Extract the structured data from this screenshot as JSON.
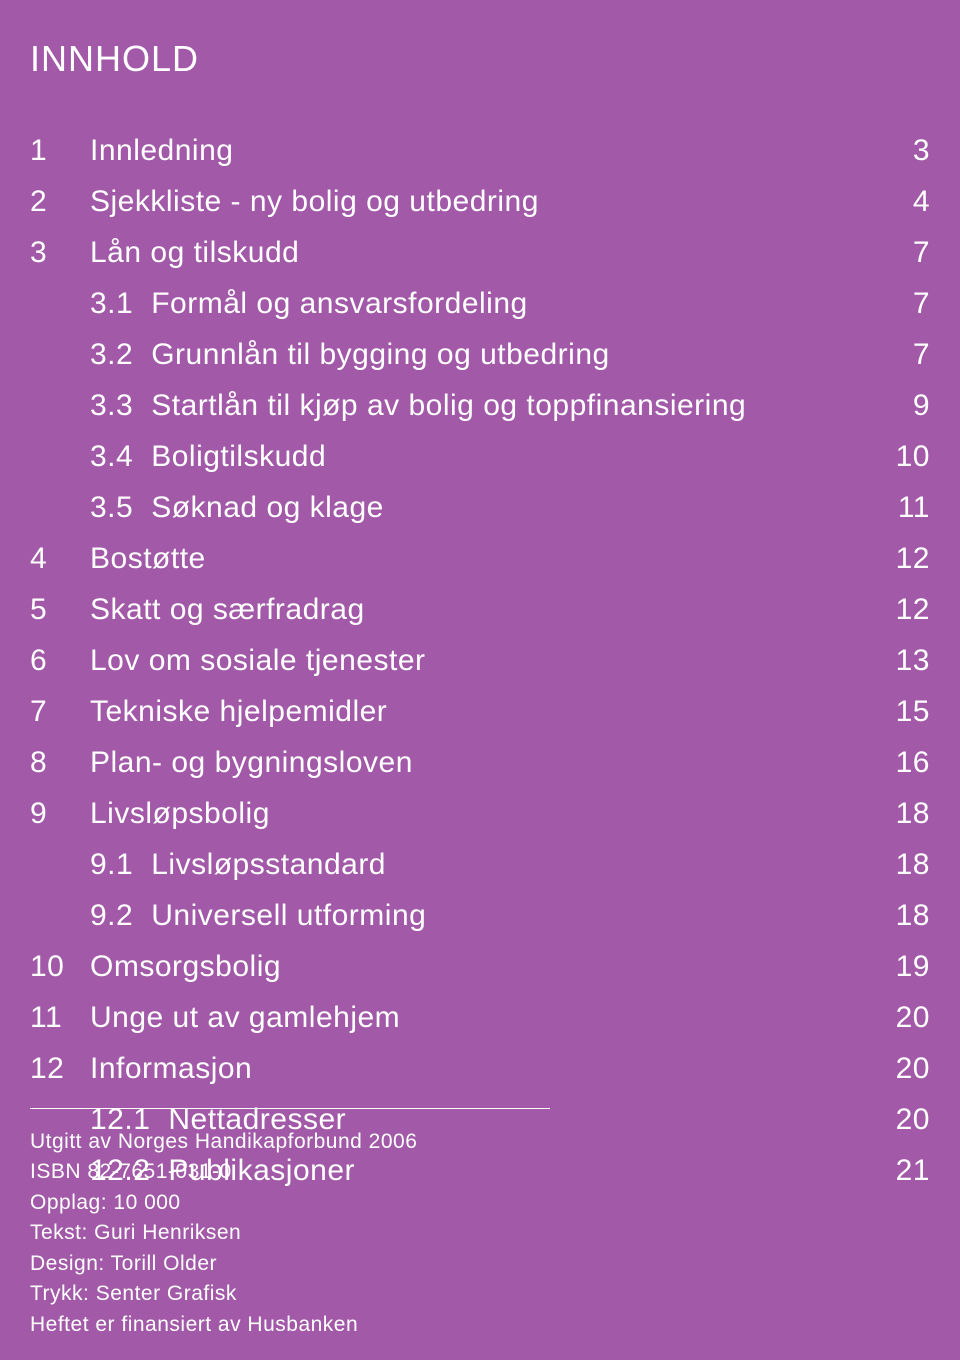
{
  "title": "INNHOLD",
  "toc": [
    {
      "num": "1",
      "sub": "",
      "label": "Innledning",
      "page": "3"
    },
    {
      "num": "2",
      "sub": "",
      "label": "Sjekkliste - ny bolig og utbedring",
      "page": "4"
    },
    {
      "num": "3",
      "sub": "",
      "label": "Lån og tilskudd",
      "page": "7"
    },
    {
      "num": "",
      "sub": "3.1",
      "label": "Formål og ansvarsfordeling",
      "page": "7"
    },
    {
      "num": "",
      "sub": "3.2",
      "label": "Grunnlån til bygging og utbedring",
      "page": "7"
    },
    {
      "num": "",
      "sub": "3.3",
      "label": "Startlån til kjøp av bolig og toppfinansiering",
      "page": "9"
    },
    {
      "num": "",
      "sub": "3.4",
      "label": "Boligtilskudd",
      "page": "10"
    },
    {
      "num": "",
      "sub": "3.5",
      "label": "Søknad og klage",
      "page": "11"
    },
    {
      "num": "4",
      "sub": "",
      "label": "Bostøtte",
      "page": "12"
    },
    {
      "num": "5",
      "sub": "",
      "label": "Skatt og særfradrag",
      "page": "12"
    },
    {
      "num": "6",
      "sub": "",
      "label": "Lov om sosiale tjenester",
      "page": "13"
    },
    {
      "num": "7",
      "sub": "",
      "label": "Tekniske hjelpemidler",
      "page": "15"
    },
    {
      "num": "8",
      "sub": "",
      "label": "Plan- og bygningsloven",
      "page": "16"
    },
    {
      "num": "9",
      "sub": "",
      "label": "Livsløpsbolig",
      "page": "18"
    },
    {
      "num": "",
      "sub": "9.1",
      "label": "Livsløpsstandard",
      "page": "18"
    },
    {
      "num": "",
      "sub": "9.2",
      "label": "Universell utforming",
      "page": "18"
    },
    {
      "num": "10",
      "sub": "",
      "label": "Omsorgsbolig",
      "page": "19"
    },
    {
      "num": "11",
      "sub": "",
      "label": "Unge ut av gamlehjem",
      "page": "20"
    },
    {
      "num": "12",
      "sub": "",
      "label": "Informasjon",
      "page": "20"
    },
    {
      "num": "",
      "sub": "12.1",
      "label": "Nettadresser",
      "page": "20"
    },
    {
      "num": "",
      "sub": "12.2",
      "label": "Publikasjoner",
      "page": "21"
    }
  ],
  "credits": [
    "Utgitt av Norges Handikapforbund 2006",
    "ISBN 82-7651-031-0",
    "Opplag: 10 000",
    "Tekst: Guri Henriksen",
    "Design: Torill Older",
    "Trykk: Senter Grafisk",
    "Heftet er finansiert av Husbanken"
  ]
}
